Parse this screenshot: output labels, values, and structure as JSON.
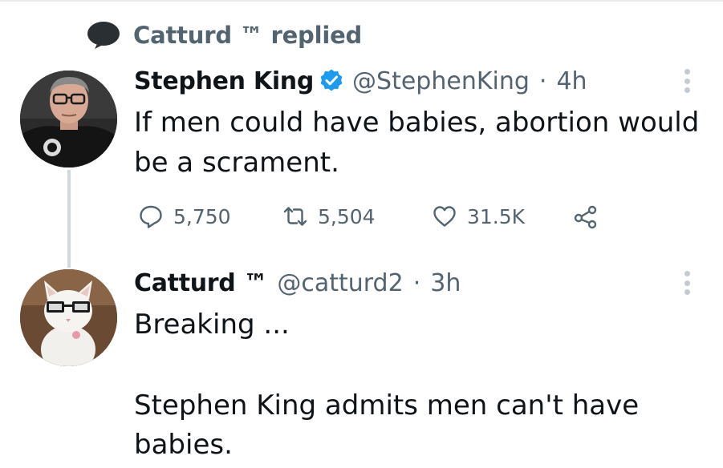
{
  "context": {
    "icon": "speech-bubble-icon",
    "text": "Catturd ™ replied"
  },
  "tweet1": {
    "author_name": "Stephen King",
    "verified": true,
    "handle": "@StephenKing",
    "separator": "·",
    "time": "4h",
    "text": "If men could have babies, abortion would be a scrament.",
    "actions": {
      "replies": "5,750",
      "retweets": "5,504",
      "likes": "31.5K"
    }
  },
  "tweet2": {
    "author_name": "Catturd ™",
    "handle": "@catturd2",
    "separator": "·",
    "time": "3h",
    "text_line1": "Breaking ...",
    "text_line2": "Stephen King admits men can't have",
    "text_line3": "babies."
  },
  "colors": {
    "primary_text": "#0f1419",
    "secondary_text": "#536471",
    "verified_blue": "#1d9bf0",
    "thread_line": "#cfd9de"
  }
}
